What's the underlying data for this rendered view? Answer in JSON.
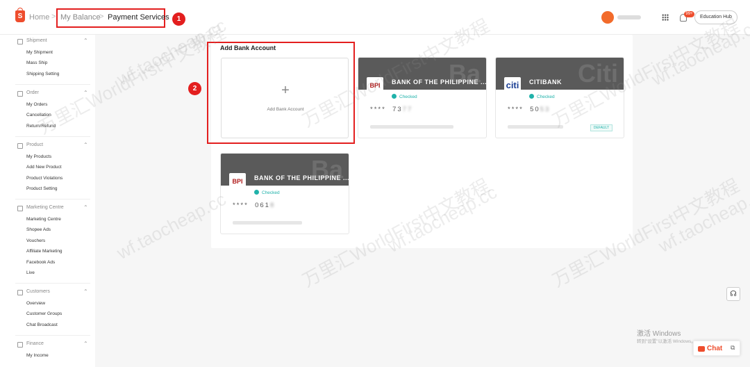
{
  "header": {
    "breadcrumb": {
      "home": "Home",
      "sep": ">",
      "balance": "My Balance",
      "current": "Payment Services"
    },
    "notification_count": "99+",
    "education_hub": "Education Hub",
    "annotation_1": "1",
    "annotation_2": "2"
  },
  "sidebar": {
    "sections": [
      {
        "title": "Shipment",
        "items": [
          "My Shipment",
          "Mass Ship",
          "Shipping Setting"
        ]
      },
      {
        "title": "Order",
        "items": [
          "My Orders",
          "Cancellation",
          "Return/Refund"
        ]
      },
      {
        "title": "Product",
        "items": [
          "My Products",
          "Add New Product",
          "Product Violations",
          "Product Setting"
        ]
      },
      {
        "title": "Marketing Centre",
        "items": [
          "Marketing Centre",
          "Shopee Ads",
          "Vouchers",
          "Affiliate Marketing",
          "Facebook Ads",
          "Live"
        ]
      },
      {
        "title": "Customers",
        "items": [
          "Overview",
          "Customer Groups",
          "Chat Broadcast"
        ]
      },
      {
        "title": "Finance",
        "items": [
          "My Income"
        ]
      }
    ]
  },
  "main": {
    "title": "Add Bank Account",
    "add_card": {
      "plus": "+",
      "label": "Add Bank Account"
    },
    "bank_cards": [
      {
        "logo": "BPI",
        "watermark": "Ba",
        "name": "BANK OF THE PHILIPPINE ...",
        "status": "Checked",
        "stars": "****",
        "acct_visible": "73",
        "acct_masked": "77",
        "default": ""
      },
      {
        "logo": "citi",
        "watermark": "Citi",
        "name": "CITIBANK",
        "status": "Checked",
        "stars": "****",
        "acct_visible": "50",
        "acct_masked": "53",
        "default": "DEFAULT"
      },
      {
        "logo": "BPI",
        "watermark": "Ba",
        "name": "BANK OF THE PHILIPPINE ...",
        "status": "Checked",
        "stars": "****",
        "acct_visible": "061",
        "acct_masked": "8",
        "default": ""
      }
    ]
  },
  "chat": {
    "label": "Chat"
  },
  "windows_activation": {
    "title": "激活 Windows",
    "subtitle": "转到\"设置\"以激活 Windows。"
  },
  "watermark_text": [
    "万里汇WorldFirst中文教程",
    "wf.taocheap.cc"
  ],
  "colors": {
    "accent": "#ee4d2d",
    "annotation_red": "#e31e1e",
    "checked_green": "#20b2aa",
    "card_header": "#5a5a5a"
  },
  "icons": {
    "logo": "shopee-bag-icon",
    "apps": "grid-icon",
    "notifications": "bell-icon",
    "support": "headset-icon",
    "chat": "chat-bubble-icon"
  }
}
